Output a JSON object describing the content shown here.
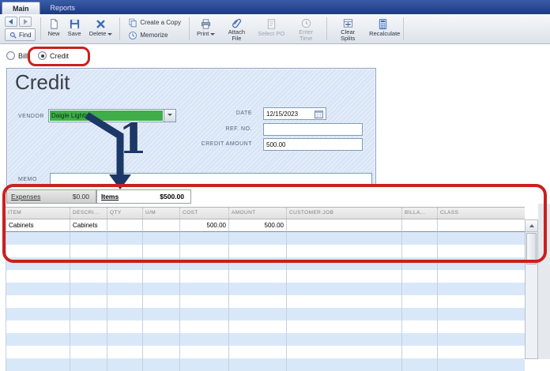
{
  "window": {
    "tabs": [
      {
        "label": "Main"
      },
      {
        "label": "Reports"
      }
    ]
  },
  "toolbar": {
    "find_label": "Find",
    "buttons": {
      "new": "New",
      "save": "Save",
      "delete": "Delete",
      "create_copy": "Create a Copy",
      "memorize": "Memorize",
      "print": "Print",
      "attach_file": "Attach File",
      "select_po": "Select PO",
      "enter_time": "Enter Time",
      "clear_splits": "Clear Splits",
      "recalculate": "Recalculate"
    }
  },
  "doc_type": {
    "bill_label": "Bill",
    "credit_label": "Credit",
    "selected": "Credit"
  },
  "form": {
    "title": "Credit",
    "vendor_label": "VENDOR",
    "vendor_value": "Daigle Lighting",
    "date_label": "DATE",
    "date_value": "12/15/2023",
    "ref_label": "REF. NO.",
    "ref_value": "",
    "credit_amount_label": "CREDIT AMOUNT",
    "credit_amount_value": "500.00",
    "memo_label": "MEMO",
    "memo_value": ""
  },
  "subtabs": {
    "expenses_label": "Expenses",
    "expenses_amount": "$0.00",
    "items_label": "Items",
    "items_amount": "$500.00"
  },
  "items_table": {
    "columns": [
      "ITEM",
      "DESCRI...",
      "QTY",
      "U/M",
      "COST",
      "AMOUNT",
      "CUSTOMER:JOB",
      "BILLA...",
      "CLASS"
    ],
    "rows": [
      {
        "item": "Cabinets",
        "description": "Cabinets",
        "qty": "",
        "um": "",
        "cost": "500.00",
        "amount": "500.00",
        "customer_job": "",
        "billable": "",
        "class": ""
      }
    ]
  },
  "annotations": {
    "step_number": "1"
  },
  "icons": {
    "back": "left-triangle",
    "forward": "right-triangle",
    "find": "magnifier",
    "new": "blank-page",
    "save": "floppy-disk",
    "delete": "blue-x",
    "create_copy": "two-pages",
    "memorize": "clock-page",
    "print": "printer",
    "attach_file": "paperclip",
    "select_po": "document-grey",
    "enter_time": "clock-grey",
    "clear_splits": "form-eraser",
    "recalculate": "calculator",
    "calendar": "calendar-grid",
    "scroll_up": "up-triangle"
  },
  "colors": {
    "annotation_red": "#c9211e",
    "arrow_navy": "#1c3868",
    "vendor_highlight_green": "#3fae49",
    "row_alt_blue": "#d9e8f8",
    "topbar_navy": "#1d3a7e"
  }
}
